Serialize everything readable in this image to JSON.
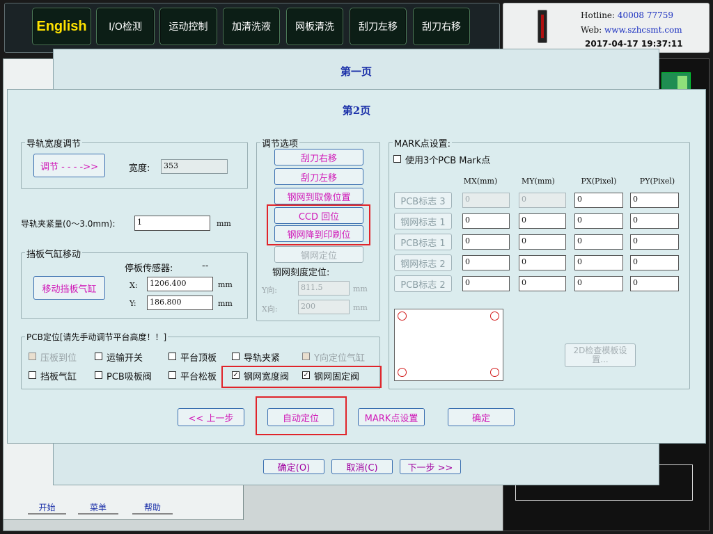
{
  "topbar": {
    "buttons": [
      "English",
      "I/O检测",
      "运动控制",
      "加清洗液",
      "网板清洗",
      "刮刀左移",
      "刮刀右移"
    ]
  },
  "info": {
    "hotline_label": "Hotline:",
    "hotline_value": "40008 77759",
    "web_label": "Web:",
    "web_value": "www.szhcsmt.com",
    "datetime": "2017-04-17  19:37:11"
  },
  "dialog1": {
    "title": "第一页"
  },
  "dialog1_buttons": {
    "ok": "确定(O)",
    "cancel": "取消(C)",
    "next": "下一步 >>"
  },
  "dialog2": {
    "title": "第2页",
    "rail": {
      "legend": "导轨宽度调节",
      "adjust_button": "调节 - - - ->>",
      "width_label": "宽度:",
      "width_value": "353"
    },
    "clamp": {
      "label": "导轨夹紧量(0～3.0mm):",
      "value": "1",
      "unit": "mm"
    },
    "stopper": {
      "legend": "挡板气缸移动",
      "sensor_label": "停板传感器:",
      "sensor_value": "--",
      "move_button": "移动挡板气缸",
      "x_label": "X:",
      "x_value": "1206.400",
      "y_label": "Y:",
      "y_value": "186.800",
      "unit": "mm"
    },
    "options": {
      "legend": "调节选项",
      "buttons": [
        "刮刀右移",
        "刮刀左移",
        "钢网到取像位置",
        "CCD 回位",
        "钢网降到印刷位",
        "钢网定位"
      ],
      "scale_label": "钢网刻度定位:",
      "y_label": "Y向:",
      "y_value": "811.5",
      "x_label": "X向:",
      "x_value": "200",
      "unit": "mm"
    },
    "mark": {
      "legend": "MARK点设置:",
      "use3_label": "使用3个PCB Mark点",
      "use3_checked": false,
      "headers": [
        "MX(mm)",
        "MY(mm)",
        "PX(Pixel)",
        "PY(Pixel)"
      ],
      "rows": [
        {
          "label": "PCB标志 3",
          "values": [
            "0",
            "0",
            "0",
            "0"
          ],
          "disabled": true
        },
        {
          "label": "钢网标志 1",
          "values": [
            "0",
            "0",
            "0",
            "0"
          ],
          "disabled": false
        },
        {
          "label": "PCB标志 1",
          "values": [
            "0",
            "0",
            "0",
            "0"
          ],
          "disabled": false
        },
        {
          "label": "钢网标志 2",
          "values": [
            "0",
            "0",
            "0",
            "0"
          ],
          "disabled": false
        },
        {
          "label": "PCB标志 2",
          "values": [
            "0",
            "0",
            "0",
            "0"
          ],
          "disabled": false
        }
      ],
      "template_button": "2D检查模板设置..."
    },
    "pcb": {
      "legend": "PCB定位[请先手动调节平台高度！！]",
      "row1": [
        "压板到位",
        "运输开关",
        "平台顶板",
        "导轨夹紧",
        "Y向定位气缸"
      ],
      "row2": [
        "挡板气缸",
        "PCB吸板阀",
        "平台松板",
        "钢网宽度阀",
        "钢网固定阀"
      ],
      "row1_checked": [
        false,
        false,
        false,
        false,
        false
      ],
      "row2_checked": [
        false,
        false,
        false,
        true,
        true
      ]
    },
    "footer": {
      "prev": "<< 上一步",
      "auto": "自动定位",
      "mark": "MARK点设置",
      "ok": "确定"
    }
  },
  "tabs": [
    "开始",
    "菜单",
    "帮助"
  ],
  "accent_colors": {
    "highlight": "#e0242a",
    "button_text": "#d01ab8",
    "title": "#1a2fa8"
  }
}
